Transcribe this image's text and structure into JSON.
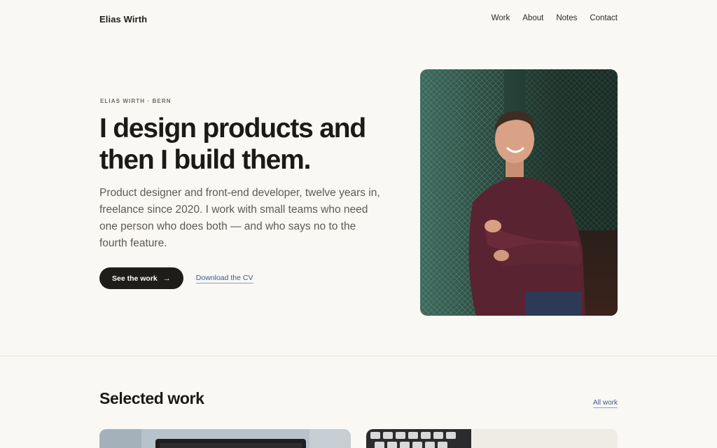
{
  "nav": {
    "brand": "Elias Wirth",
    "links": [
      "Work",
      "About",
      "Notes",
      "Contact"
    ]
  },
  "hero": {
    "eyebrow": "ELIAS WIRTH · BERN",
    "headline_line1": "I design products and",
    "headline_line2": "then I build them.",
    "intro": "Product designer and front-end developer, twelve years in, freelance since 2020. I work with small teams who need one person who does both — and who says no to the fourth feature.",
    "primary_button": "See the work",
    "primary_button_icon": "arrow-right-icon",
    "secondary_link": "Download the CV"
  },
  "work": {
    "title": "Selected work",
    "all_link": "All work"
  },
  "colors": {
    "background": "#faf8f4",
    "text": "#1f1d1a",
    "accent_link": "#3b5a8a",
    "button_bg": "#1f1d1a"
  }
}
